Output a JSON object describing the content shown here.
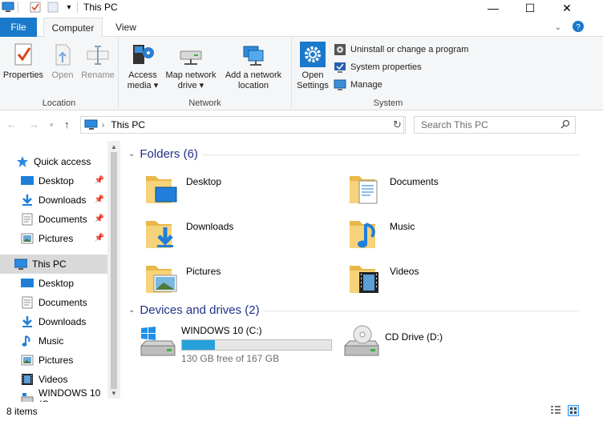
{
  "window": {
    "title": "This PC",
    "minimize_glyph": "—",
    "maximize_glyph": "☐",
    "close_glyph": "✕"
  },
  "tabs": {
    "file": "File",
    "computer": "Computer",
    "view": "View",
    "active": "Computer"
  },
  "ribbon": {
    "location": {
      "label": "Location",
      "properties": "Properties",
      "open": "Open",
      "rename": "Rename"
    },
    "network": {
      "label": "Network",
      "access_media_line1": "Access",
      "access_media_line2": "media",
      "map_drive_line1": "Map network",
      "map_drive_line2": "drive",
      "add_location_line1": "Add a network",
      "add_location_line2": "location"
    },
    "system": {
      "label": "System",
      "open_settings_line1": "Open",
      "open_settings_line2": "Settings",
      "uninstall": "Uninstall or change a program",
      "system_properties": "System properties",
      "manage": "Manage"
    },
    "dropdown_glyph": "▾"
  },
  "address": {
    "path": "This PC",
    "search_placeholder": "Search This PC"
  },
  "navpane": {
    "quick_access": "Quick access",
    "quick_items": [
      "Desktop",
      "Downloads",
      "Documents",
      "Pictures"
    ],
    "this_pc": "This PC",
    "pc_items": [
      "Desktop",
      "Documents",
      "Downloads",
      "Music",
      "Pictures",
      "Videos",
      "WINDOWS 10 (C"
    ]
  },
  "content": {
    "folders_header": "Folders (6)",
    "folders": [
      "Desktop",
      "Documents",
      "Downloads",
      "Music",
      "Pictures",
      "Videos"
    ],
    "devices_header": "Devices and drives (2)",
    "drive_c": {
      "name": "WINDOWS 10 (C:)",
      "free_text": "130 GB free of 167 GB",
      "used_fraction": 0.22
    },
    "drive_d": {
      "name": "CD Drive (D:)"
    }
  },
  "status": {
    "items": "8 items"
  },
  "colors": {
    "accent": "#1979ca",
    "header_text": "#1e3287",
    "selection": "#cce8ff",
    "drive_fill": "#26a0da"
  }
}
